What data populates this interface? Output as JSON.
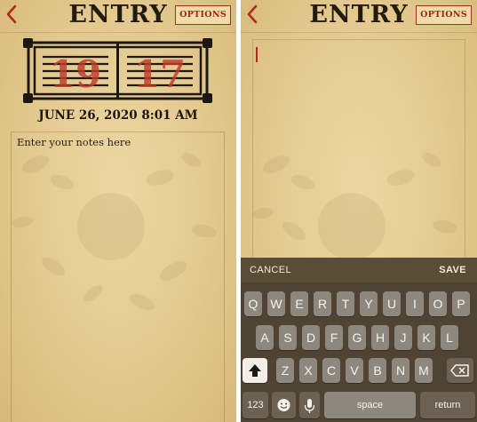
{
  "left_screen": {
    "header": {
      "title": "ENTRY",
      "options_label": "OPTIONS",
      "back_icon": "chevron-left-icon"
    },
    "entry_number": {
      "left_digits": "19",
      "right_digits": "17"
    },
    "date_text": "JUNE 26, 2020 8:01 AM",
    "notes": {
      "placeholder": "Enter your notes here"
    }
  },
  "right_screen": {
    "header": {
      "title": "ENTRY",
      "options_label": "OPTIONS",
      "back_icon": "chevron-left-icon"
    },
    "keyboard_toolbar": {
      "cancel_label": "CANCEL",
      "save_label": "SAVE"
    },
    "keyboard": {
      "row1": [
        "Q",
        "W",
        "E",
        "R",
        "T",
        "Y",
        "U",
        "I",
        "O",
        "P"
      ],
      "row2": [
        "A",
        "S",
        "D",
        "F",
        "G",
        "H",
        "J",
        "K",
        "L"
      ],
      "row3": [
        "Z",
        "X",
        "C",
        "V",
        "B",
        "N",
        "M"
      ],
      "numbers_label": "123",
      "space_label": "space",
      "return_label": "return"
    }
  },
  "colors": {
    "accent_red": "#b02a1e",
    "title_ink": "#231a10",
    "parchment": "#e3c98e",
    "keyboard_bg": "#4f4434"
  }
}
